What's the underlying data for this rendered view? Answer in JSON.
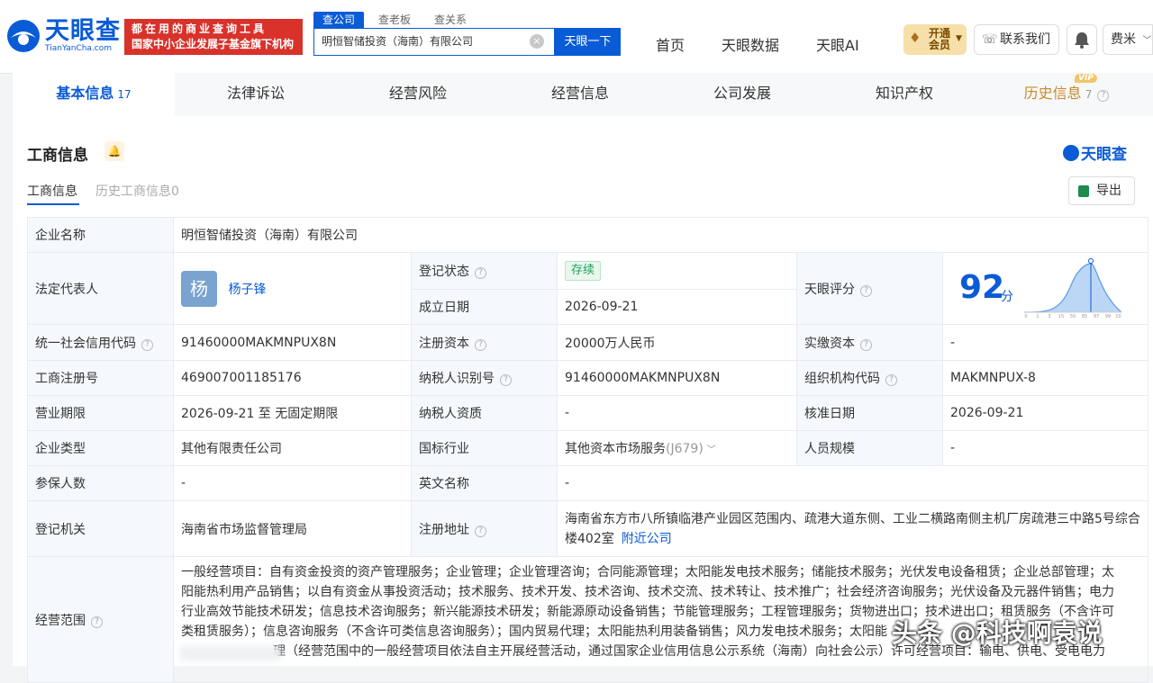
{
  "header": {
    "logo_cn": "天眼查",
    "logo_en": "TianYanCha.com",
    "slogan_line1": "都在用的商业查询工具",
    "slogan_line2": "国家中小企业发展子基金旗下机构",
    "search_tabs": [
      "查公司",
      "查老板",
      "查关系"
    ],
    "search_value": "明恒智储投资（海南）有限公司",
    "search_button": "天眼一下",
    "nav": [
      "首页",
      "天眼数据",
      "天眼AI"
    ],
    "vip_line1": "开通",
    "vip_line2": "会员",
    "contact": "联系我们",
    "user": "费米"
  },
  "tabs": [
    {
      "label": "基本信息",
      "count": "17"
    },
    {
      "label": "法律诉讼",
      "count": ""
    },
    {
      "label": "经营风险",
      "count": ""
    },
    {
      "label": "经营信息",
      "count": ""
    },
    {
      "label": "公司发展",
      "count": ""
    },
    {
      "label": "知识产权",
      "count": ""
    },
    {
      "label": "历史信息",
      "count": "7"
    }
  ],
  "vip_tag": "VIP",
  "section": {
    "title": "工商信息",
    "brand": "天眼查",
    "subtabs": [
      "工商信息",
      "历史工商信息0"
    ],
    "export": "导出"
  },
  "info": {
    "company_name_label": "企业名称",
    "company_name": "明恒智储投资（海南）有限公司",
    "legal_rep_label": "法定代表人",
    "legal_rep_avatar": "杨",
    "legal_rep": "杨子锋",
    "reg_status_label": "登记状态",
    "reg_status": "存续",
    "established_label": "成立日期",
    "established": "2026-09-21",
    "score_label": "天眼评分",
    "score": "92",
    "score_unit": "分",
    "score_axis": [
      "0",
      "1",
      "3",
      "15",
      "50",
      "85",
      "97",
      "99",
      "100"
    ],
    "credit_code_label": "统一社会信用代码",
    "credit_code": "91460000MAKMNPUX8N",
    "reg_capital_label": "注册资本",
    "reg_capital": "20000万人民币",
    "paid_capital_label": "实缴资本",
    "paid_capital": "-",
    "reg_no_label": "工商注册号",
    "reg_no": "469007001185176",
    "taxpayer_id_label": "纳税人识别号",
    "taxpayer_id": "91460000MAKMNPUX8N",
    "org_code_label": "组织机构代码",
    "org_code": "MAKMNPUX-8",
    "term_label": "营业期限",
    "term": "2026-09-21 至 无固定期限",
    "taxpayer_qual_label": "纳税人资质",
    "taxpayer_qual": "-",
    "approval_date_label": "核准日期",
    "approval_date": "2026-09-21",
    "type_label": "企业类型",
    "type": "其他有限责任公司",
    "industry_label": "国标行业",
    "industry": "其他资本市场服务",
    "industry_code": "(J679)",
    "staff_label": "人员规模",
    "staff": "-",
    "insured_label": "参保人数",
    "insured": "-",
    "english_label": "英文名称",
    "english": "-",
    "authority_label": "登记机关",
    "authority": "海南省市场监督管理局",
    "address_label": "注册地址",
    "address": "海南省东方市八所镇临港产业园区范围内、疏港大道东侧、工业二横路南侧主机厂房疏港三中路5号综合楼402室",
    "nearby": "附近公司",
    "scope_label": "经营范围",
    "scope_lines": [
      "一般经营项目：自有资金投资的资产管理服务；企业管理；企业管理咨询；合同能源管理；太阳能发电技术服务；储能技术服务；光伏发电设备租赁；企业总部管理；太",
      "阳能热利用产品销售；以自有资金从事投资活动；技术服务、技术开发、技术咨询、技术交流、技术转让、技术推广；社会经济咨询服务；光伏设备及元器件销售；电力",
      "行业高效节能技术研发；信息技术咨询服务；新兴能源技术研发；新能源原动设备销售；节能管理服务；工程管理服务；货物进出口；技术进出口；租赁服务（不含许可",
      "类租赁服务）；信息咨询服务（不含许可类信息咨询服务）；国内贸易代理；太阳能热利用装备销售；风力发电技术服务；太阳能",
      "理（经营范围中的一般经营项目依法自主开展经营活动，通过国家企业信用信息公示系统（海南）向社会公示）许可经营项目：输电、供电、受电电力"
    ]
  },
  "watermark": "头条 @科技啊袁说"
}
